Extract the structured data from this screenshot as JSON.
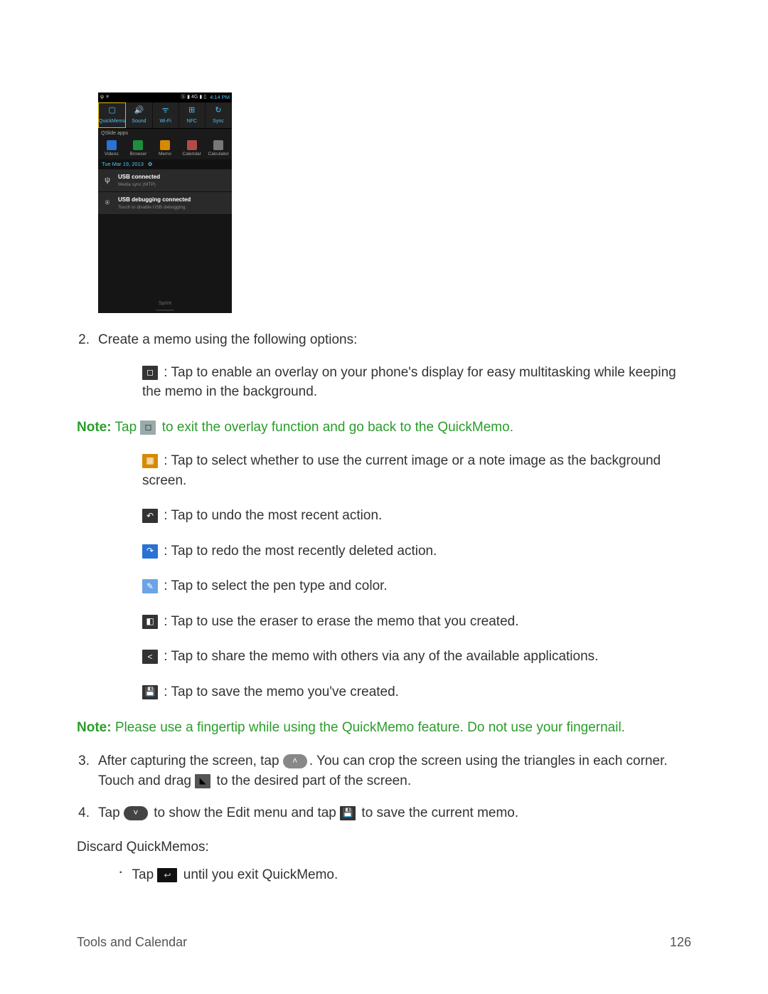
{
  "phone": {
    "time": "4:14 PM",
    "toggles": [
      {
        "label": "QuickMemo",
        "icon": "✎"
      },
      {
        "label": "Sound",
        "icon": "🔊"
      },
      {
        "label": "Wi-Fi",
        "icon": "📶"
      },
      {
        "label": "NFC",
        "icon": "⬚"
      },
      {
        "label": "Sync",
        "icon": "↻"
      }
    ],
    "qslide_label": "QSlide apps",
    "apps": [
      {
        "label": "Videos"
      },
      {
        "label": "Browser"
      },
      {
        "label": "Memo"
      },
      {
        "label": "Calendar"
      },
      {
        "label": "Calculator"
      }
    ],
    "date": "Tue Mar 19, 2013",
    "notif1": {
      "title": "USB connected",
      "sub": "Media sync (MTP)"
    },
    "notif2": {
      "title": "USB debugging connected",
      "sub": "Touch to disable USB debugging."
    },
    "carrier": "Sprint"
  },
  "step2": {
    "num": "2.",
    "text": "Create a memo using the following options:"
  },
  "items": {
    "overlay": ": Tap to enable an overlay on your phone's display for easy multitasking while keeping the memo in the background.",
    "notelabel": "Note:",
    "note1a": " Tap ",
    "note1b": " to exit the overlay function and go back to the QuickMemo.",
    "bg": ": Tap to select whether to use the current image or a note image as the background screen.",
    "undo": ": Tap to undo the most recent action.",
    "redo": ": Tap to redo the most recently deleted action.",
    "pen": ": Tap to select the pen type and color.",
    "eraser": ": Tap to use the eraser to erase the memo that you created.",
    "share": ": Tap to share the memo with others via any of the available applications.",
    "save": ": Tap to save the memo you've created."
  },
  "note2": " Please use a fingertip while using the QuickMemo feature. Do not use your fingernail.",
  "step3": {
    "num": "3.",
    "a": "After capturing the screen, tap ",
    "b": ". You can crop the screen using the triangles in each corner. Touch and drag ",
    "c": " to the desired part of the screen."
  },
  "step4": {
    "num": "4.",
    "a": "Tap ",
    "b": " to show the Edit menu and tap ",
    "c": " to save the current memo."
  },
  "discard": "Discard QuickMemos:",
  "bullet": {
    "a": "Tap ",
    "b": " until you exit QuickMemo."
  },
  "footer": {
    "left": "Tools and Calendar",
    "right": "126"
  }
}
